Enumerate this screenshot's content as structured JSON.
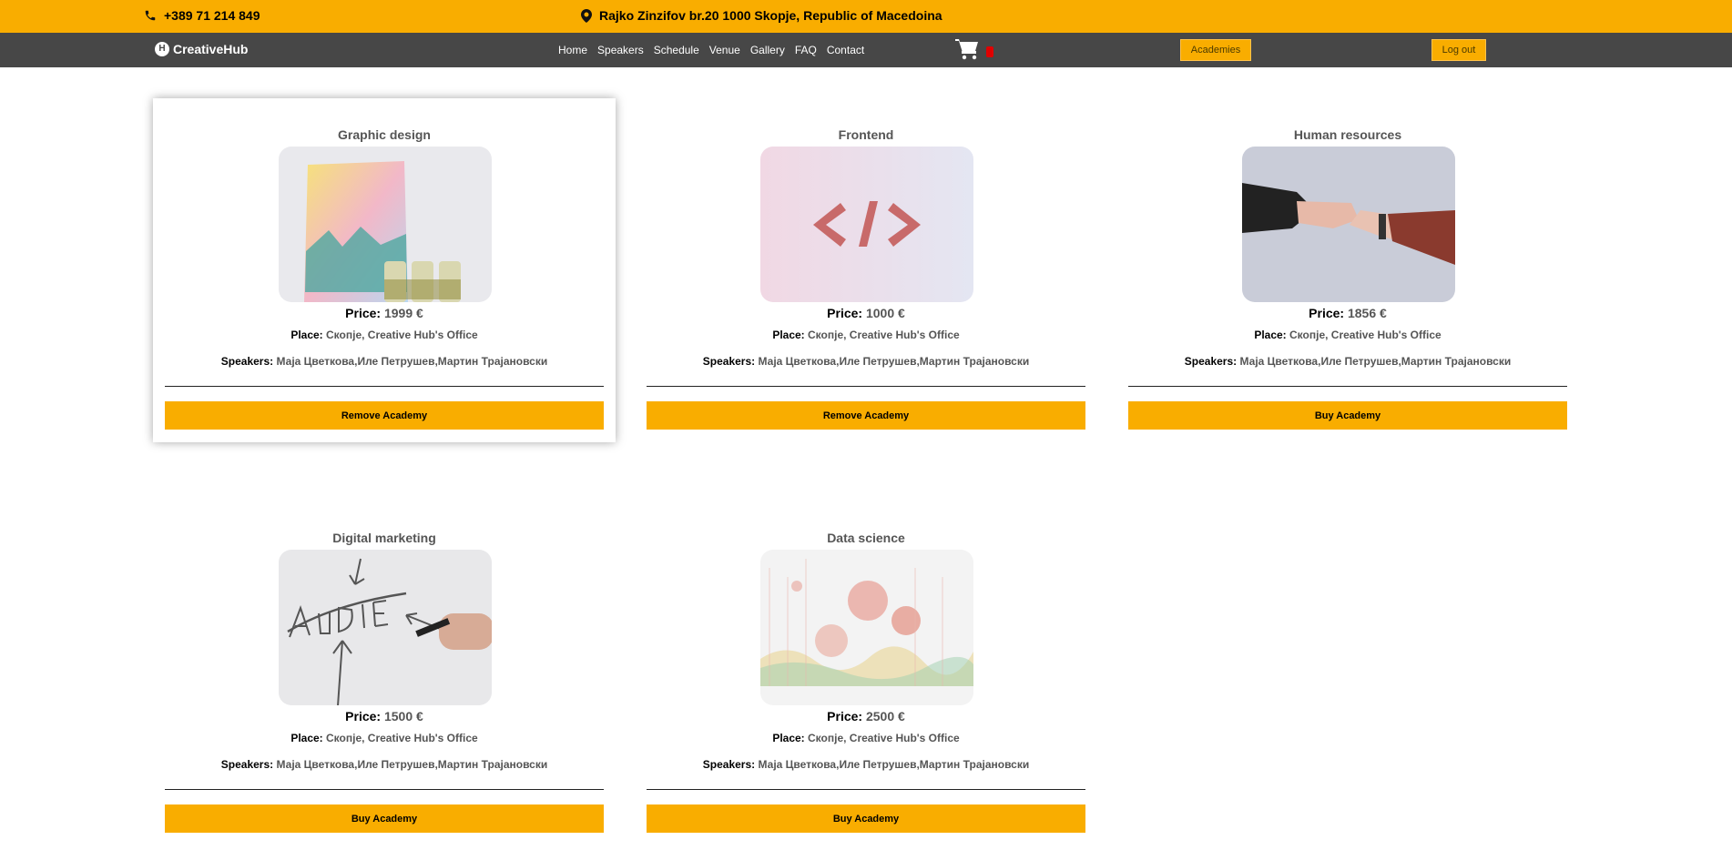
{
  "topbar": {
    "phone": "+389 71 214 849",
    "address": "Rajko Zinzifov br.20 1000 Skopje, Republic of Macedoina"
  },
  "navbar": {
    "brand": "CreativeHub",
    "links": [
      "Home",
      "Speakers",
      "Schedule",
      "Venue",
      "Gallery",
      "FAQ",
      "Contact"
    ],
    "academies_label": "Academies",
    "logout_label": "Log out",
    "cart_icon": "shopping-cart-icon",
    "badge_color": "#e00000"
  },
  "labels": {
    "price": "Price:",
    "place": "Place:",
    "speakers": "Speakers:"
  },
  "academies": [
    {
      "title": "Graphic design",
      "price": "1999 €",
      "place": "Скопје, Creative Hub's Office",
      "speakers": "Маја Цветкова,Иле Петрушев,Мартин Трајановски",
      "action": "Remove Academy",
      "image": "graphic-design-image"
    },
    {
      "title": "Frontend",
      "price": "1000 €",
      "place": "Скопје, Creative Hub's Office",
      "speakers": "Маја Цветкова,Иле Петрушев,Мартин Трајановски",
      "action": "Remove Academy",
      "image": "frontend-code-image"
    },
    {
      "title": "Human resources",
      "price": "1856 €",
      "place": "Скопје, Creative Hub's Office",
      "speakers": "Маја Цветкова,Иле Петрушев,Мартин Трајановски",
      "action": "Buy Academy",
      "image": "handshake-image"
    },
    {
      "title": "Digital marketing",
      "price": "1500 €",
      "place": "Скопје, Creative Hub's Office",
      "speakers": "Маја Цветкова,Иле Петрушев,Мартин Трајановски",
      "action": "Buy Academy",
      "image": "audience-whiteboard-image"
    },
    {
      "title": "Data science",
      "price": "2500 €",
      "place": "Скопје, Creative Hub's Office",
      "speakers": "Маја Цветкова,Иле Петрушев,Мартин Трајановски",
      "action": "Buy Academy",
      "image": "data-visualization-image"
    }
  ],
  "colors": {
    "accent": "#f9ad00",
    "navbar": "#474747"
  }
}
